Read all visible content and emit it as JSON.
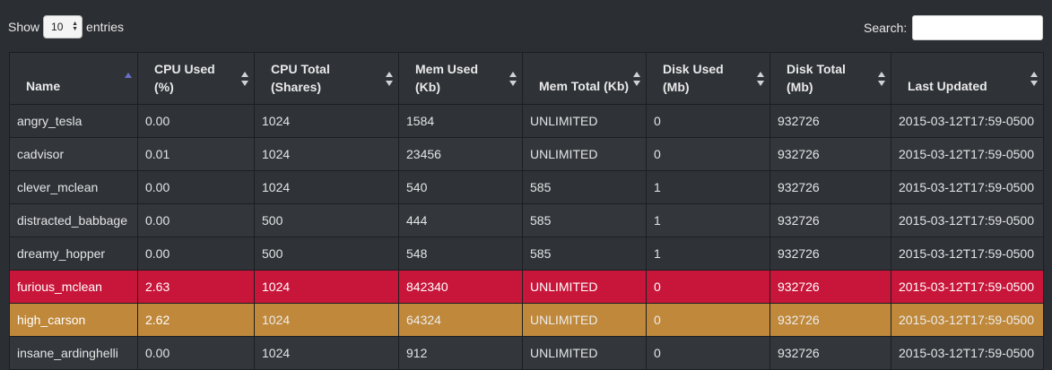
{
  "controls": {
    "show_label": "Show",
    "entries_value": "10",
    "entries_label": "entries",
    "search_label": "Search:",
    "search_value": ""
  },
  "table": {
    "columns": [
      {
        "line1": "Name",
        "line2": ""
      },
      {
        "line1": "CPU Used",
        "line2": "(%)"
      },
      {
        "line1": "CPU Total",
        "line2": "(Shares)"
      },
      {
        "line1": "Mem Used",
        "line2": "(Kb)"
      },
      {
        "line1": "Mem Total (Kb)",
        "line2": ""
      },
      {
        "line1": "Disk Used",
        "line2": "(Mb)"
      },
      {
        "line1": "Disk Total",
        "line2": "(Mb)"
      },
      {
        "line1": "Last Updated",
        "line2": ""
      }
    ],
    "rows": [
      [
        "angry_tesla",
        "0.00",
        "1024",
        "1584",
        "UNLIMITED",
        "0",
        "932726",
        "2015-03-12T17:59-0500"
      ],
      [
        "cadvisor",
        "0.01",
        "1024",
        "23456",
        "UNLIMITED",
        "0",
        "932726",
        "2015-03-12T17:59-0500"
      ],
      [
        "clever_mclean",
        "0.00",
        "1024",
        "540",
        "585",
        "1",
        "932726",
        "2015-03-12T17:59-0500"
      ],
      [
        "distracted_babbage",
        "0.00",
        "500",
        "444",
        "585",
        "1",
        "932726",
        "2015-03-12T17:59-0500"
      ],
      [
        "dreamy_hopper",
        "0.00",
        "500",
        "548",
        "585",
        "1",
        "932726",
        "2015-03-12T17:59-0500"
      ],
      [
        "furious_mclean",
        "2.63",
        "1024",
        "842340",
        "UNLIMITED",
        "0",
        "932726",
        "2015-03-12T17:59-0500"
      ],
      [
        "high_carson",
        "2.62",
        "1024",
        "64324",
        "UNLIMITED",
        "0",
        "932726",
        "2015-03-12T17:59-0500"
      ],
      [
        "insane_ardinghelli",
        "0.00",
        "1024",
        "912",
        "UNLIMITED",
        "0",
        "932726",
        "2015-03-12T17:59-0500"
      ]
    ],
    "highlight_colors": {
      "red": "#c8163a",
      "orange": "#bf883a"
    }
  }
}
